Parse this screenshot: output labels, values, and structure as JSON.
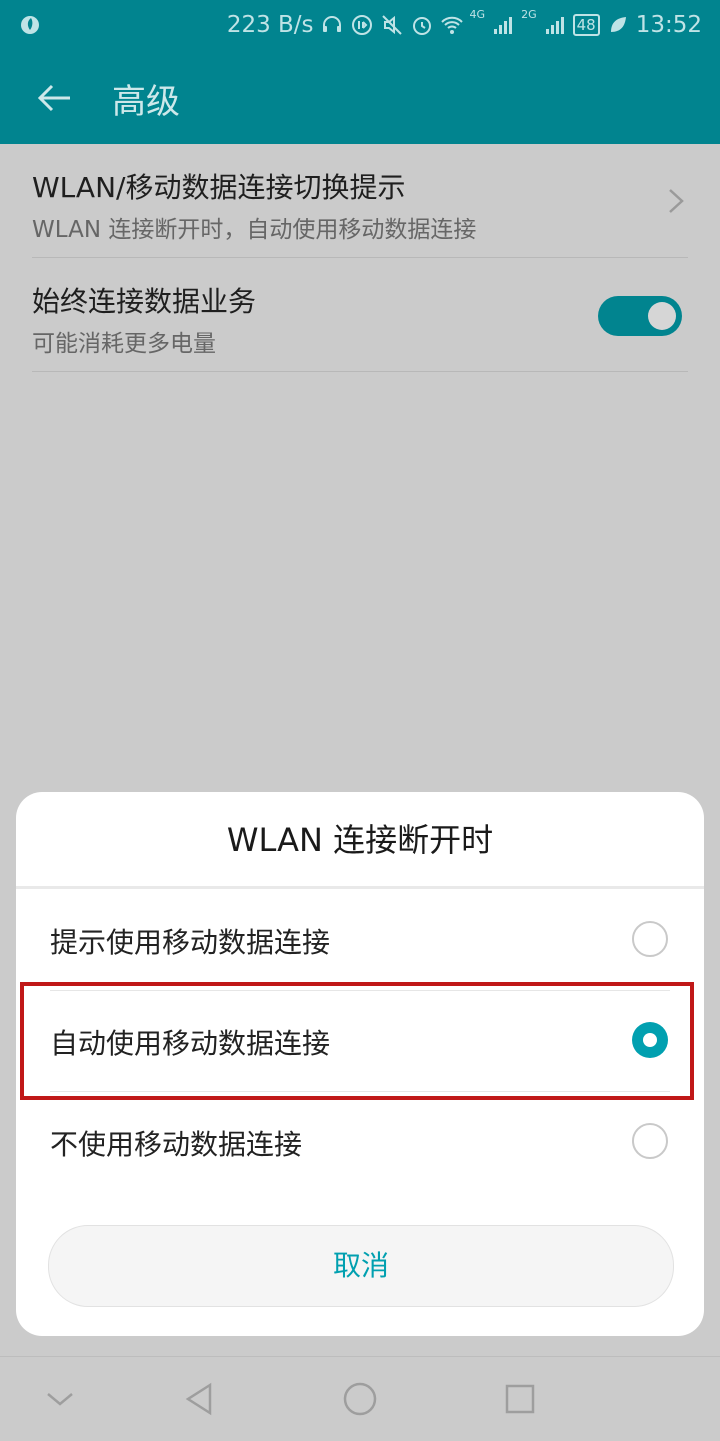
{
  "status_bar": {
    "speed": "223 B/s",
    "net_1": "4G",
    "net_2": "2G",
    "battery": "48",
    "time": "13:52",
    "icons": [
      "app-logo-icon",
      "headset-icon",
      "hd-call-icon",
      "mute-icon",
      "alarm-icon",
      "wifi-icon",
      "signal-icon",
      "signal-icon",
      "battery-icon",
      "leaf-icon"
    ]
  },
  "app_bar": {
    "title": "高级"
  },
  "settings": [
    {
      "title": "WLAN/移动数据连接切换提示",
      "subtitle": "WLAN 连接断开时，自动使用移动数据连接"
    },
    {
      "title": "始终连接数据业务",
      "subtitle": "可能消耗更多电量",
      "toggle_on": true
    }
  ],
  "dialog": {
    "title": "WLAN 连接断开时",
    "options": [
      {
        "label": "提示使用移动数据连接",
        "selected": false
      },
      {
        "label": "自动使用移动数据连接",
        "selected": true
      },
      {
        "label": "不使用移动数据连接",
        "selected": false
      }
    ],
    "cancel_label": "取消"
  },
  "colors": {
    "accent": "#01848f",
    "radio_accent": "#01a0b0",
    "highlight": "#c01818"
  }
}
